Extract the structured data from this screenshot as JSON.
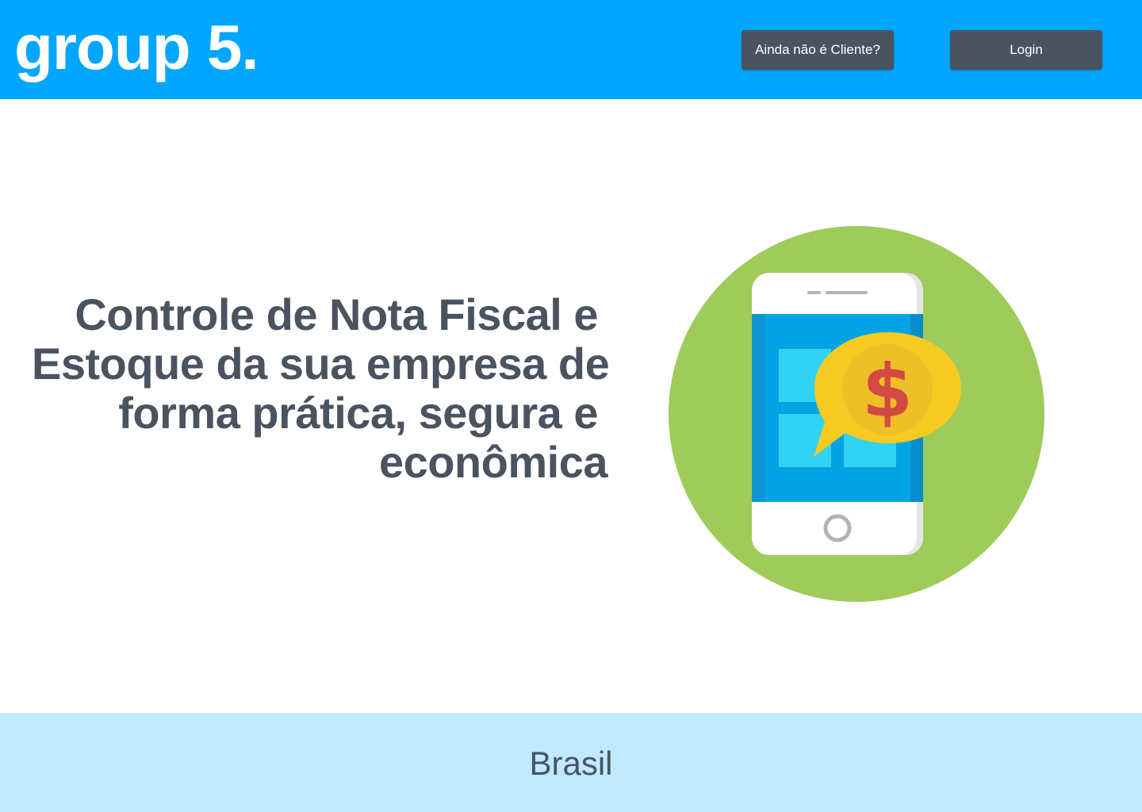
{
  "header": {
    "brand": "group 5.",
    "signup_label": "Ainda não é Cliente?",
    "login_label": "Login"
  },
  "hero": {
    "line1": "Controle de Nota Fiscal e",
    "line2": "Estoque da sua empresa de",
    "line3": "forma prática, segura e",
    "line4": "econômica"
  },
  "illustration": {
    "icon": "phone-money-icon",
    "currency_symbol": "$"
  },
  "footer": {
    "text": "Brasil"
  },
  "colors": {
    "header_bg": "#03a6fe",
    "button_bg": "#4a5360",
    "text_dark": "#4a5360",
    "footer_bg": "#c0e9fe",
    "circle_green": "#9fcb5b"
  }
}
